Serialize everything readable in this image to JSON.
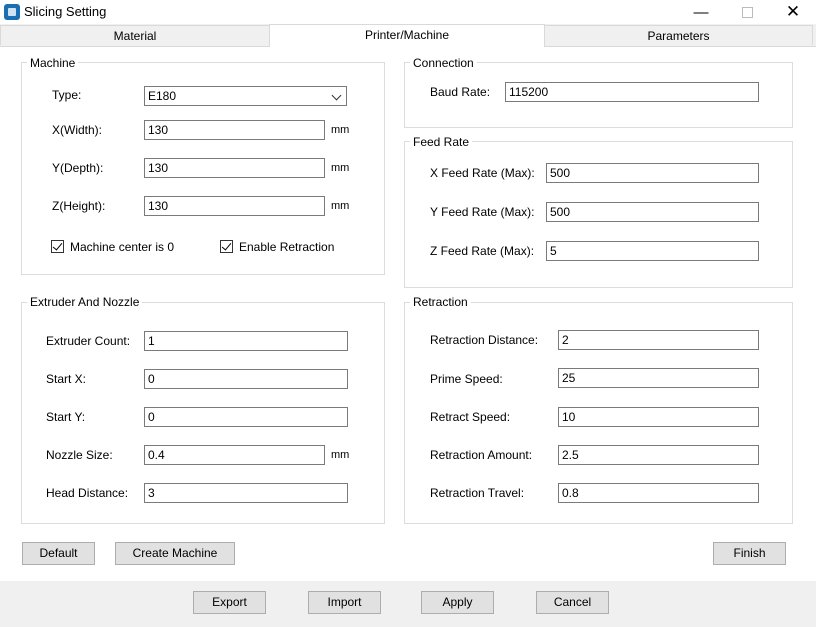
{
  "window": {
    "title": "Slicing Setting"
  },
  "tabs": [
    {
      "label": "Material"
    },
    {
      "label": "Printer/Machine"
    },
    {
      "label": "Parameters"
    }
  ],
  "machine": {
    "title": "Machine",
    "type_label": "Type:",
    "type_value": "E180",
    "x_label": "X(Width):",
    "x_value": "130",
    "y_label": "Y(Depth):",
    "y_value": "130",
    "z_label": "Z(Height):",
    "z_value": "130",
    "unit": "mm",
    "center_label": "Machine center is 0",
    "retraction_label": "Enable Retraction"
  },
  "connection": {
    "title": "Connection",
    "baud_label": "Baud Rate:",
    "baud_value": "115200"
  },
  "feed_rate": {
    "title": "Feed Rate",
    "x_label": "X Feed Rate (Max):",
    "x_value": "500",
    "y_label": "Y Feed Rate (Max):",
    "y_value": "500",
    "z_label": "Z Feed Rate (Max):",
    "z_value": "5"
  },
  "extruder": {
    "title": "Extruder And Nozzle",
    "count_label": "Extruder Count:",
    "count_value": "1",
    "startx_label": "Start X:",
    "startx_value": "0",
    "starty_label": "Start Y:",
    "starty_value": "0",
    "nozzle_label": "Nozzle Size:",
    "nozzle_value": "0.4",
    "unit": "mm",
    "head_label": "Head Distance:",
    "head_value": "3"
  },
  "retraction": {
    "title": "Retraction",
    "distance_label": "Retraction Distance:",
    "distance_value": "2",
    "prime_label": "Prime Speed:",
    "prime_value": "25",
    "retract_label": "Retract Speed:",
    "retract_value": "10",
    "amount_label": "Retraction Amount:",
    "amount_value": "2.5",
    "travel_label": "Retraction Travel:",
    "travel_value": "0.8"
  },
  "buttons": {
    "default": "Default",
    "create_machine": "Create Machine",
    "finish": "Finish",
    "export": "Export",
    "import": "Import",
    "apply": "Apply",
    "cancel": "Cancel"
  }
}
